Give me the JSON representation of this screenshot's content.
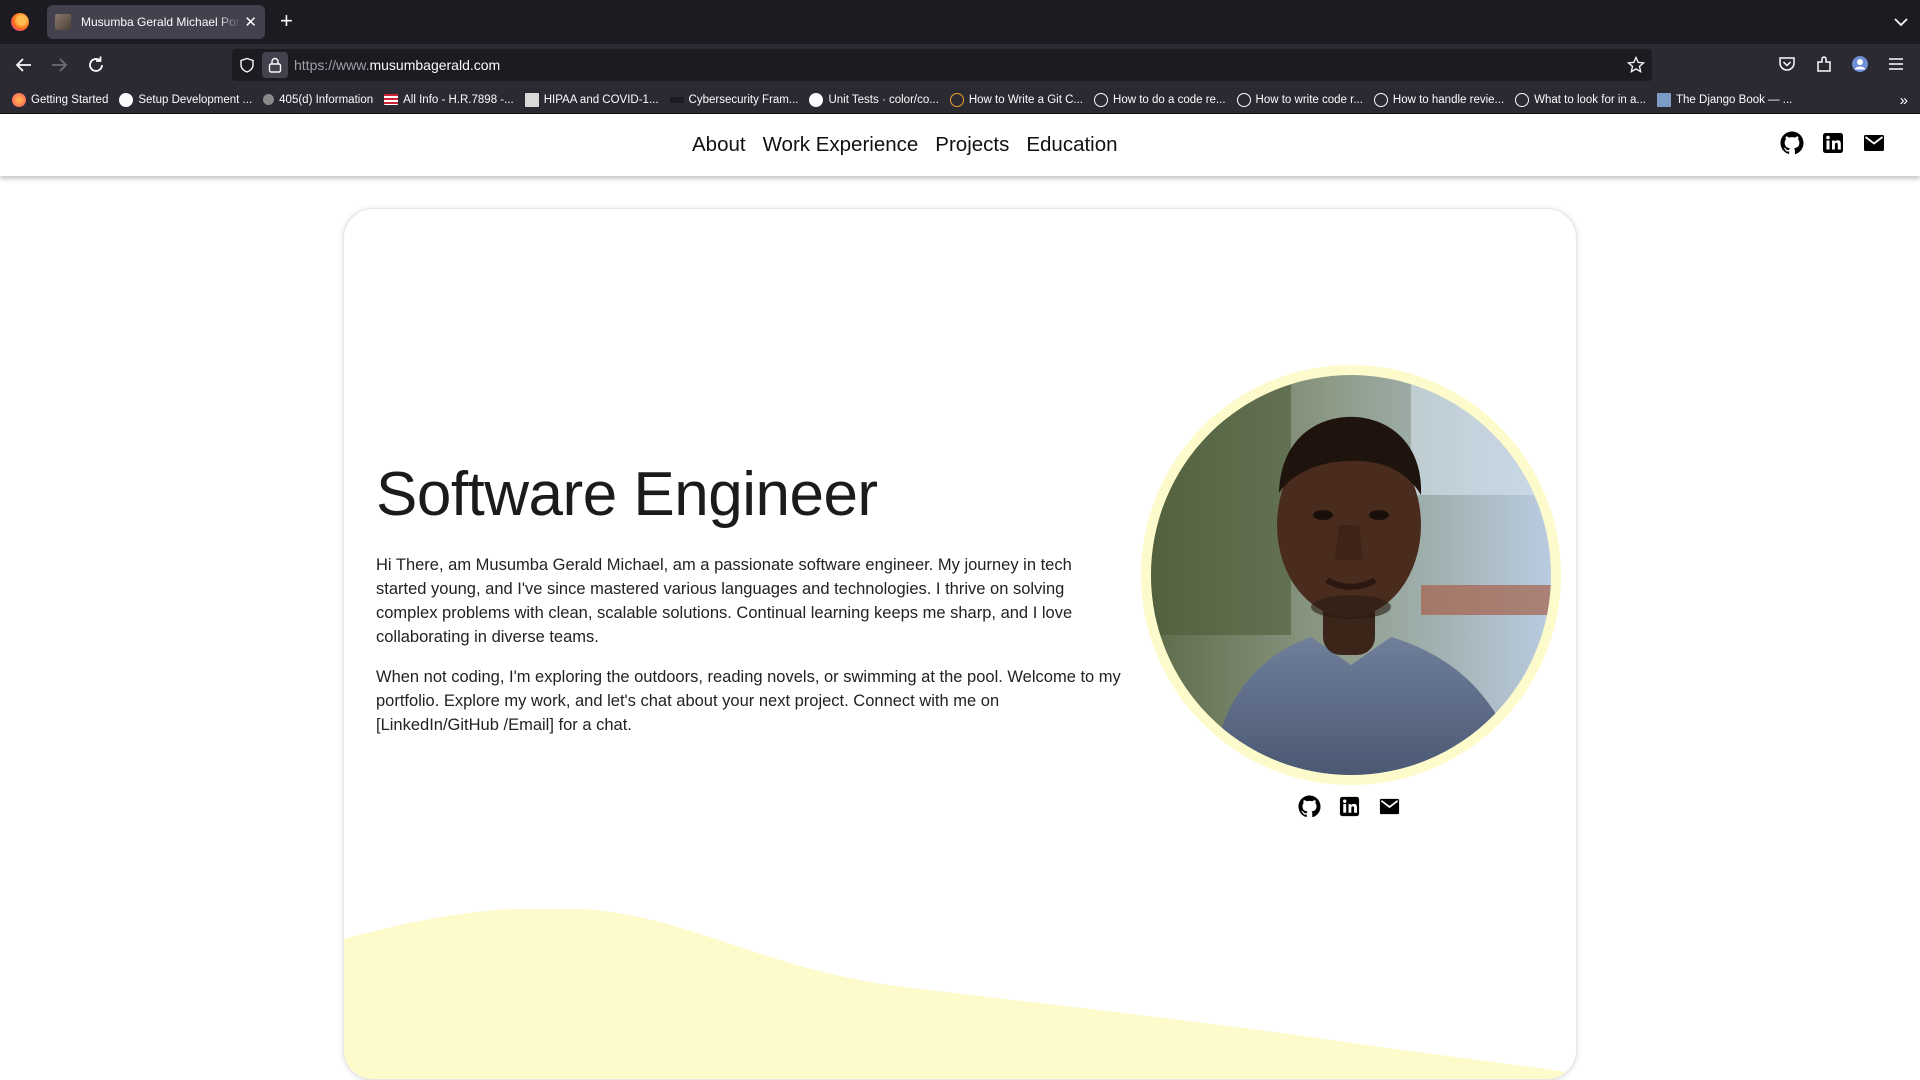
{
  "browser": {
    "tab_title": "Musumba Gerald Michael Portfolio",
    "url_prefix": "https://www.",
    "url_domain": "musumbagerald.com",
    "bookmarks": [
      "Getting Started",
      "Setup Development ...",
      "405(d) Information",
      "All Info - H.R.7898 -...",
      "HIPAA and COVID-1...",
      "Cybersecurity Fram...",
      "Unit Tests · color/co...",
      "How to Write a Git C...",
      "How to do a code re...",
      "How to write code r...",
      "How to handle revie...",
      "What to look for in a...",
      "The Django Book — ..."
    ]
  },
  "nav": {
    "items": [
      "About",
      "Work Experience",
      "Projects",
      "Education"
    ],
    "icons": [
      "github-icon",
      "linkedin-icon",
      "email-icon"
    ]
  },
  "hero": {
    "title": "Software Engineer",
    "paragraph_1": "Hi There, am Musumba Gerald Michael, am a passionate software engineer. My journey in tech started young, and I've since mastered various languages and technologies. I thrive on solving complex problems with clean, scalable solutions. Continual learning keeps me sharp, and I love collaborating in diverse teams.",
    "paragraph_2": "When not coding, I'm exploring the outdoors, reading novels, or swimming at the pool. Welcome to my portfolio. Explore my work, and let's chat about your next project. Connect with me on [LinkedIn/GitHub /Email] for a chat."
  },
  "colors": {
    "accent_yellow": "#fdfbcb",
    "chrome_dark": "#1c1b22",
    "chrome": "#2b2a33"
  }
}
